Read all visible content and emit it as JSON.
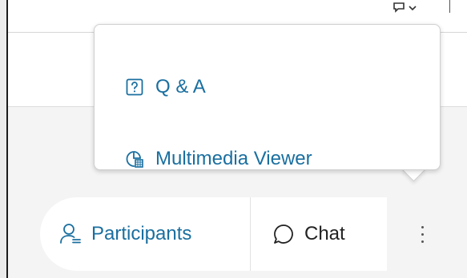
{
  "popup_menu": {
    "items": [
      {
        "label": "Q & A",
        "icon": "question-box-icon"
      },
      {
        "label": "Multimedia Viewer",
        "icon": "multimedia-viewer-icon"
      }
    ]
  },
  "toolbar": {
    "participants_label": "Participants",
    "chat_label": "Chat",
    "more_icon": "more-vertical-icon"
  },
  "colors": {
    "accent": "#1a6fa0",
    "text": "#222222",
    "background": "#f4f4f4"
  }
}
